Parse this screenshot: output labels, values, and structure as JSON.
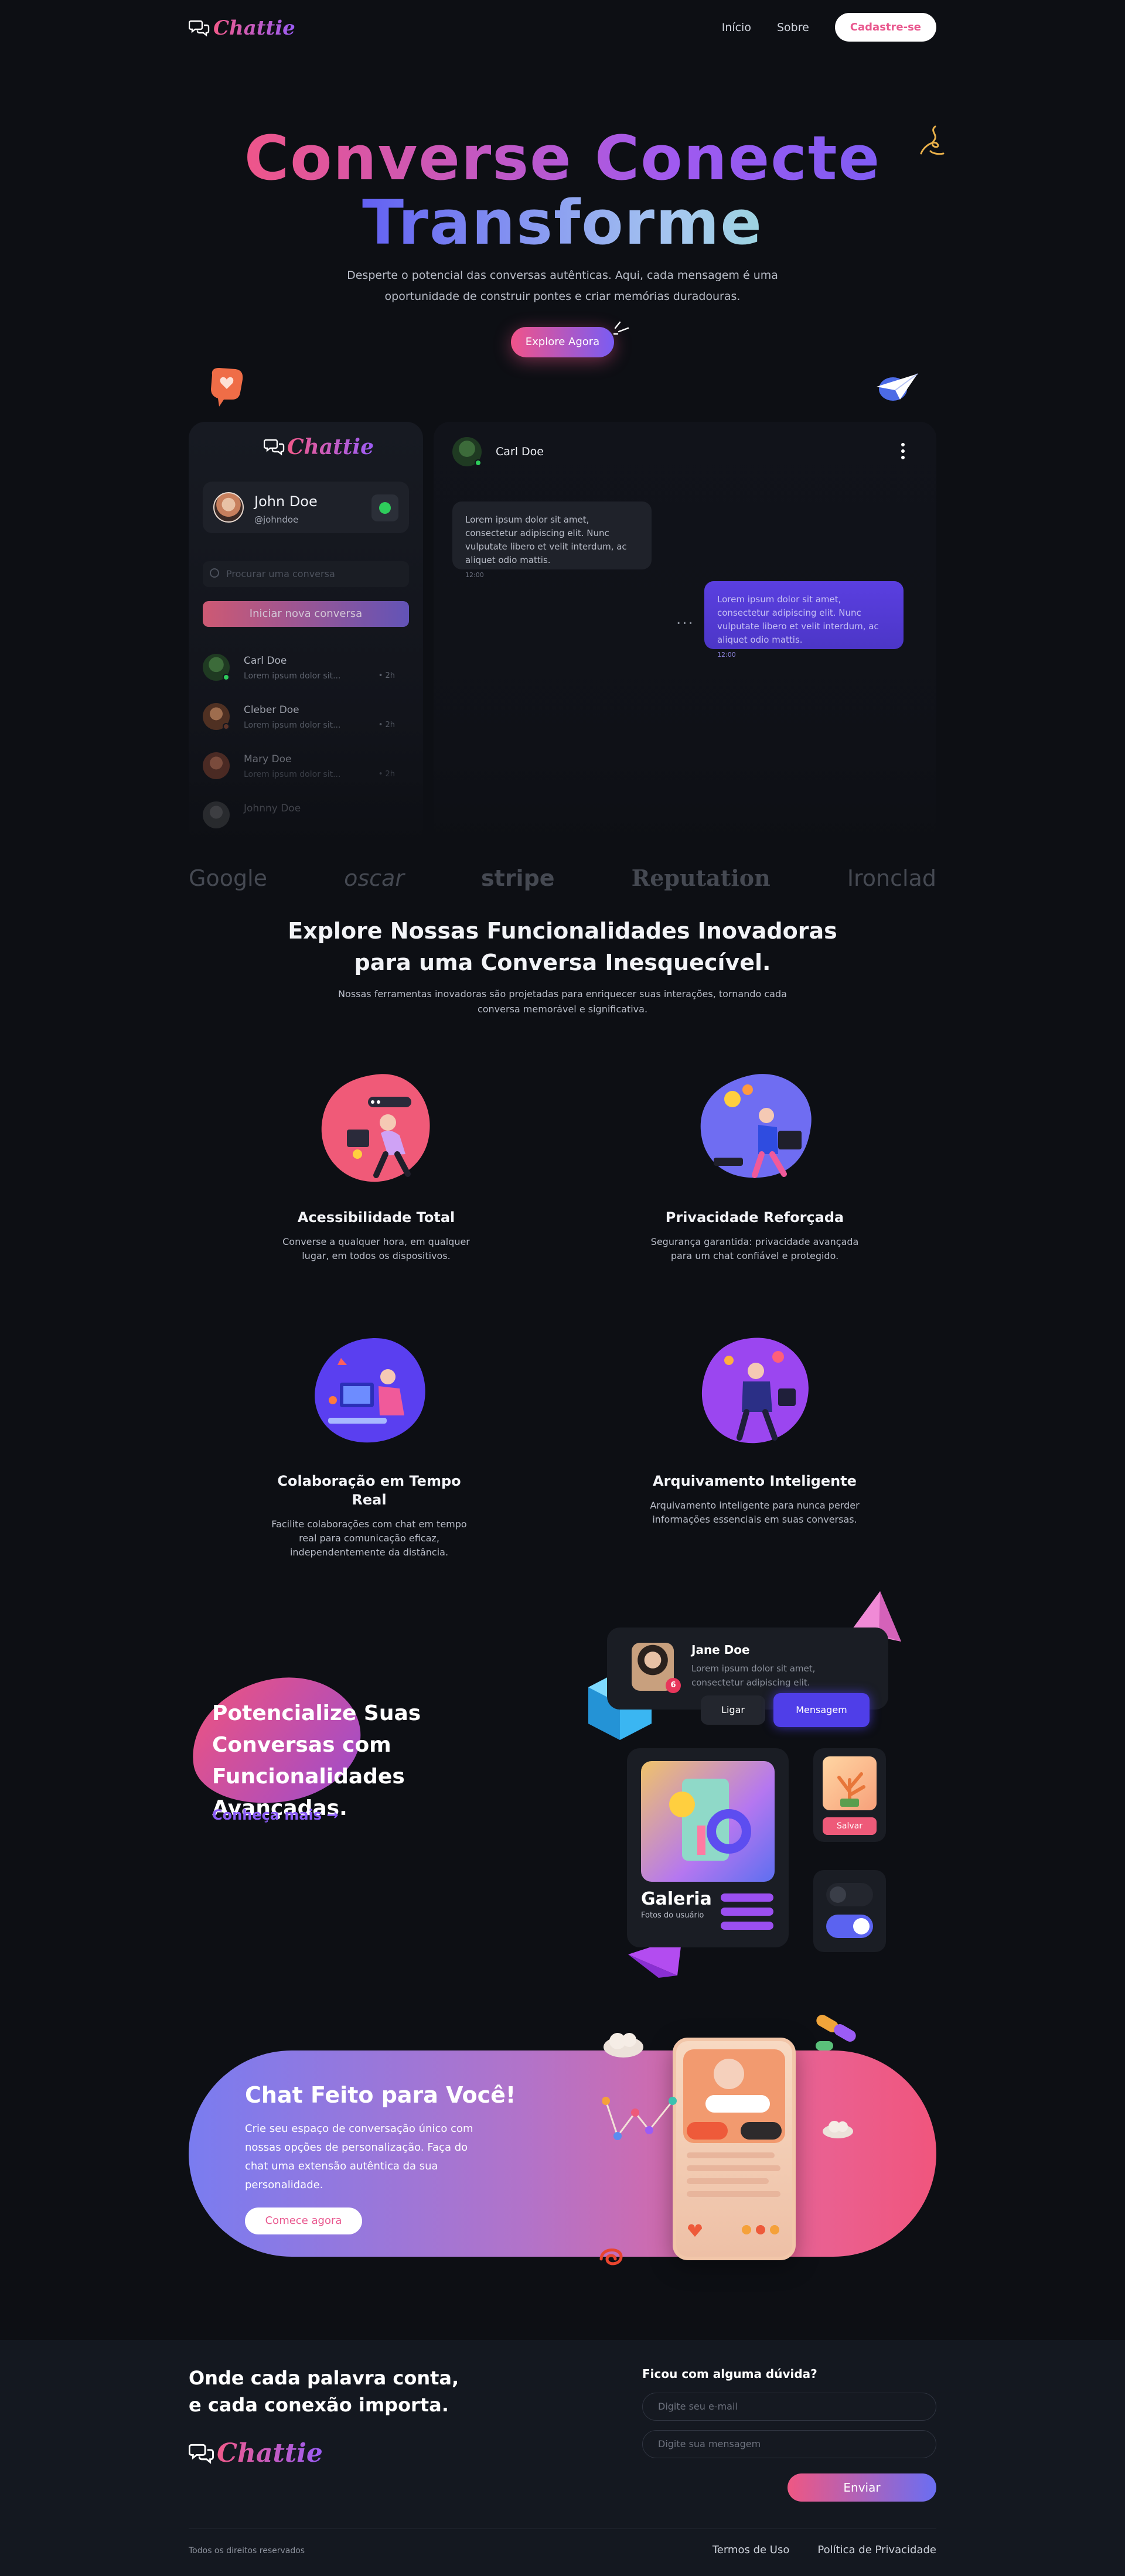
{
  "header": {
    "logo": "Chattie",
    "nav": [
      "Início",
      "Sobre"
    ],
    "signup": "Cadastre-se"
  },
  "hero": {
    "title_line1": "Converse Conecte",
    "title_line2": "Transforme",
    "subtitle": "Desperte o potencial das conversas autênticas. Aqui, cada mensagem é uma oportunidade de construir pontes e criar memórias duradouras.",
    "cta": "Explore Agora"
  },
  "chat_preview": {
    "logo": "Chattie",
    "user": {
      "name": "John Doe",
      "handle": "@johndoe"
    },
    "search_placeholder": "Procurar uma conversa",
    "start_button": "Iniciar nova conversa",
    "conversations": [
      {
        "name": "Carl Doe",
        "preview": "Lorem ipsum dolor sit...",
        "time": "• 2h"
      },
      {
        "name": "Cleber Doe",
        "preview": "Lorem ipsum dolor sit...",
        "time": "• 2h"
      },
      {
        "name": "Mary Doe",
        "preview": "Lorem ipsum dolor sit...",
        "time": "• 2h"
      },
      {
        "name": "Johnny Doe",
        "preview": "",
        "time": ""
      }
    ],
    "contact": "Carl Doe",
    "message_in": "Lorem ipsum dolor sit amet, consectetur adipiscing elit. Nunc vulputate libero et velit interdum, ac aliquet odio mattis.",
    "message_in_time": "12:00",
    "message_out": "Lorem ipsum dolor sit amet, consectetur adipiscing elit. Nunc vulputate libero et velit interdum, ac aliquet odio mattis.",
    "message_out_time": "12:00",
    "typing": "..."
  },
  "brands": [
    "Google",
    "oscar",
    "stripe",
    "Reputation",
    "Ironclad"
  ],
  "features": {
    "title_line1": "Explore Nossas Funcionalidades Inovadoras",
    "title_line2": "para uma Conversa Inesquecível.",
    "subtitle": "Nossas ferramentas inovadoras são projetadas para enriquecer suas interações, tornando cada conversa memorável e significativa.",
    "items": [
      {
        "title": "Acessibilidade Total",
        "text": "Converse a qualquer hora, em qualquer lugar, em todos os dispositivos."
      },
      {
        "title": "Privacidade Reforçada",
        "text": "Segurança garantida: privacidade avançada para um chat confiável e protegido."
      },
      {
        "title": "Colaboração em Tempo Real",
        "text": "Facilite colaborações com chat em tempo real para comunicação eficaz, independentemente da distância."
      },
      {
        "title": "Arquivamento Inteligente",
        "text": "Arquivamento inteligente para nunca perder informações essenciais em suas conversas."
      }
    ]
  },
  "potencialize": {
    "title": "Potencialize Suas Conversas com Funcionalidades Avançadas.",
    "link": "Conheça mais →",
    "card": {
      "name": "Jane Doe",
      "message": "Lorem ipsum dolor sit amet, consectetur adipiscing elit.",
      "badge": "6"
    },
    "call": "Ligar",
    "message_btn": "Mensagem",
    "gallery_title": "Galeria",
    "gallery_sub": "Fotos do usuário",
    "save": "Salvar"
  },
  "cta_banner": {
    "title": "Chat Feito para Você!",
    "text": "Crie seu espaço de conversação único com nossas opções de personalização. Faça do chat uma extensão autêntica da sua personalidade.",
    "button": "Comece agora"
  },
  "footer": {
    "title_line1": "Onde cada palavra conta,",
    "title_line2": "e cada conexão importa.",
    "logo": "Chattie",
    "question": "Ficou com alguma dúvida?",
    "email_placeholder": "Digite seu e-mail",
    "message_placeholder": "Digite sua mensagem",
    "send": "Enviar",
    "rights": "Todos os direitos reservados",
    "links": [
      "Termos de Uso",
      "Política de Privacidade"
    ]
  },
  "colors": {
    "background": "#0d0f14",
    "accent_pink": "#f0538a",
    "accent_purple": "#7a5cf3",
    "online": "#2ecc5b"
  }
}
